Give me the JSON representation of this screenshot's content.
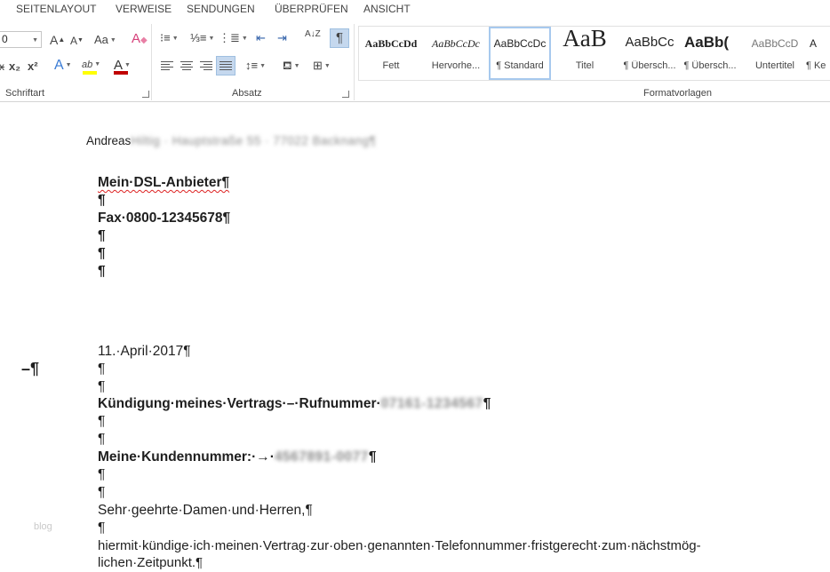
{
  "tabs": [
    "SEITENLAYOUT",
    "VERWEISE",
    "SENDUNGEN",
    "ÜBERPRÜFEN",
    "ANSICHT"
  ],
  "ribbon": {
    "font_group_label": "Schriftart",
    "paragraph_group_label": "Absatz",
    "styles_group_label": "Formatvorlagen",
    "font_size_value": "0",
    "case_button": "Aa",
    "grow_font": "A",
    "shrink_font": "A",
    "subscript": "x₂",
    "superscript": "x²",
    "text_effects": "A",
    "highlight": "ab",
    "font_color": "A",
    "sort_icon": "A↓Z",
    "pilcrow": "¶",
    "highlight_color": "#ffff00",
    "font_color_bar": "#c00000",
    "styles": [
      {
        "sample": "AaBbCcDd",
        "name": "Fett"
      },
      {
        "sample": "AaBbCcDc",
        "name": "Hervorhe..."
      },
      {
        "sample": "AaBbCcDc",
        "name": "¶ Standard"
      },
      {
        "sample": "AaB",
        "name": "Titel"
      },
      {
        "sample": "AaBbCc",
        "name": "¶ Übersch..."
      },
      {
        "sample": "AaBb(",
        "name": "¶ Übersch..."
      },
      {
        "sample": "AaBbCcD",
        "name": "Untertitel"
      },
      {
        "sample": "A",
        "name": "¶ Ke"
      }
    ]
  },
  "ruler_mark": "ıı",
  "document": {
    "sender_name": "Andreas",
    "sender_rest": "Hiltig · Hauptstraße 55 · 77022 Backnang¶",
    "recipient_name": "Mein·DSL-Anbieter¶",
    "fax": "Fax·0800-12345678¶",
    "pilcrow": "¶",
    "margin_mark": "–¶",
    "date": "11.·April·2017¶",
    "subject": "Kündigung·meines·Vertrags·–·Rufnummer·",
    "subject_number": "07161-1234567",
    "subject_end": "¶",
    "customer_label": "Meine·Kundennummer:·→·",
    "customer_number": "4567891-0077",
    "customer_end": "¶",
    "salutation": "Sehr·geehrte·Damen·und·Herren,¶",
    "body_line1": "hiermit·kündige·ich·meinen·Vertrag·zur·oben·genannten·Telefonnummer·fristgerecht·zum·nächstmög-",
    "body_line2": "lichen·Zeitpunkt.¶",
    "watermark": "blog"
  }
}
